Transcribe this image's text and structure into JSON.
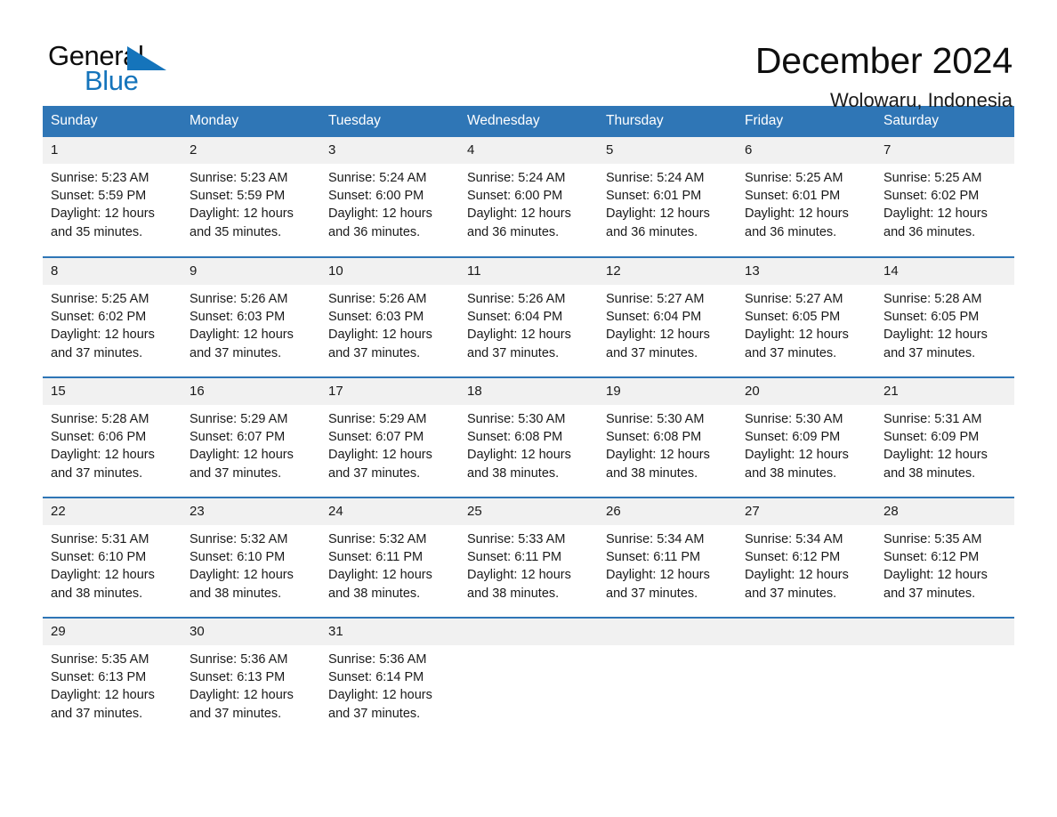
{
  "brand": {
    "name_part1": "General",
    "name_part2": "Blue",
    "accent_color": "#1574bb"
  },
  "header": {
    "title": "December 2024",
    "location": "Wolowaru, Indonesia"
  },
  "theme": {
    "header_blue": "#2f76b6",
    "daynum_bg": "#f1f1f1"
  },
  "weekdays": [
    "Sunday",
    "Monday",
    "Tuesday",
    "Wednesday",
    "Thursday",
    "Friday",
    "Saturday"
  ],
  "weeks": [
    [
      {
        "day": "1",
        "sunrise": "Sunrise: 5:23 AM",
        "sunset": "Sunset: 5:59 PM",
        "daylight": "Daylight: 12 hours\nand 35 minutes."
      },
      {
        "day": "2",
        "sunrise": "Sunrise: 5:23 AM",
        "sunset": "Sunset: 5:59 PM",
        "daylight": "Daylight: 12 hours\nand 35 minutes."
      },
      {
        "day": "3",
        "sunrise": "Sunrise: 5:24 AM",
        "sunset": "Sunset: 6:00 PM",
        "daylight": "Daylight: 12 hours\nand 36 minutes."
      },
      {
        "day": "4",
        "sunrise": "Sunrise: 5:24 AM",
        "sunset": "Sunset: 6:00 PM",
        "daylight": "Daylight: 12 hours\nand 36 minutes."
      },
      {
        "day": "5",
        "sunrise": "Sunrise: 5:24 AM",
        "sunset": "Sunset: 6:01 PM",
        "daylight": "Daylight: 12 hours\nand 36 minutes."
      },
      {
        "day": "6",
        "sunrise": "Sunrise: 5:25 AM",
        "sunset": "Sunset: 6:01 PM",
        "daylight": "Daylight: 12 hours\nand 36 minutes."
      },
      {
        "day": "7",
        "sunrise": "Sunrise: 5:25 AM",
        "sunset": "Sunset: 6:02 PM",
        "daylight": "Daylight: 12 hours\nand 36 minutes."
      }
    ],
    [
      {
        "day": "8",
        "sunrise": "Sunrise: 5:25 AM",
        "sunset": "Sunset: 6:02 PM",
        "daylight": "Daylight: 12 hours\nand 37 minutes."
      },
      {
        "day": "9",
        "sunrise": "Sunrise: 5:26 AM",
        "sunset": "Sunset: 6:03 PM",
        "daylight": "Daylight: 12 hours\nand 37 minutes."
      },
      {
        "day": "10",
        "sunrise": "Sunrise: 5:26 AM",
        "sunset": "Sunset: 6:03 PM",
        "daylight": "Daylight: 12 hours\nand 37 minutes."
      },
      {
        "day": "11",
        "sunrise": "Sunrise: 5:26 AM",
        "sunset": "Sunset: 6:04 PM",
        "daylight": "Daylight: 12 hours\nand 37 minutes."
      },
      {
        "day": "12",
        "sunrise": "Sunrise: 5:27 AM",
        "sunset": "Sunset: 6:04 PM",
        "daylight": "Daylight: 12 hours\nand 37 minutes."
      },
      {
        "day": "13",
        "sunrise": "Sunrise: 5:27 AM",
        "sunset": "Sunset: 6:05 PM",
        "daylight": "Daylight: 12 hours\nand 37 minutes."
      },
      {
        "day": "14",
        "sunrise": "Sunrise: 5:28 AM",
        "sunset": "Sunset: 6:05 PM",
        "daylight": "Daylight: 12 hours\nand 37 minutes."
      }
    ],
    [
      {
        "day": "15",
        "sunrise": "Sunrise: 5:28 AM",
        "sunset": "Sunset: 6:06 PM",
        "daylight": "Daylight: 12 hours\nand 37 minutes."
      },
      {
        "day": "16",
        "sunrise": "Sunrise: 5:29 AM",
        "sunset": "Sunset: 6:07 PM",
        "daylight": "Daylight: 12 hours\nand 37 minutes."
      },
      {
        "day": "17",
        "sunrise": "Sunrise: 5:29 AM",
        "sunset": "Sunset: 6:07 PM",
        "daylight": "Daylight: 12 hours\nand 37 minutes."
      },
      {
        "day": "18",
        "sunrise": "Sunrise: 5:30 AM",
        "sunset": "Sunset: 6:08 PM",
        "daylight": "Daylight: 12 hours\nand 38 minutes."
      },
      {
        "day": "19",
        "sunrise": "Sunrise: 5:30 AM",
        "sunset": "Sunset: 6:08 PM",
        "daylight": "Daylight: 12 hours\nand 38 minutes."
      },
      {
        "day": "20",
        "sunrise": "Sunrise: 5:30 AM",
        "sunset": "Sunset: 6:09 PM",
        "daylight": "Daylight: 12 hours\nand 38 minutes."
      },
      {
        "day": "21",
        "sunrise": "Sunrise: 5:31 AM",
        "sunset": "Sunset: 6:09 PM",
        "daylight": "Daylight: 12 hours\nand 38 minutes."
      }
    ],
    [
      {
        "day": "22",
        "sunrise": "Sunrise: 5:31 AM",
        "sunset": "Sunset: 6:10 PM",
        "daylight": "Daylight: 12 hours\nand 38 minutes."
      },
      {
        "day": "23",
        "sunrise": "Sunrise: 5:32 AM",
        "sunset": "Sunset: 6:10 PM",
        "daylight": "Daylight: 12 hours\nand 38 minutes."
      },
      {
        "day": "24",
        "sunrise": "Sunrise: 5:32 AM",
        "sunset": "Sunset: 6:11 PM",
        "daylight": "Daylight: 12 hours\nand 38 minutes."
      },
      {
        "day": "25",
        "sunrise": "Sunrise: 5:33 AM",
        "sunset": "Sunset: 6:11 PM",
        "daylight": "Daylight: 12 hours\nand 38 minutes."
      },
      {
        "day": "26",
        "sunrise": "Sunrise: 5:34 AM",
        "sunset": "Sunset: 6:11 PM",
        "daylight": "Daylight: 12 hours\nand 37 minutes."
      },
      {
        "day": "27",
        "sunrise": "Sunrise: 5:34 AM",
        "sunset": "Sunset: 6:12 PM",
        "daylight": "Daylight: 12 hours\nand 37 minutes."
      },
      {
        "day": "28",
        "sunrise": "Sunrise: 5:35 AM",
        "sunset": "Sunset: 6:12 PM",
        "daylight": "Daylight: 12 hours\nand 37 minutes."
      }
    ],
    [
      {
        "day": "29",
        "sunrise": "Sunrise: 5:35 AM",
        "sunset": "Sunset: 6:13 PM",
        "daylight": "Daylight: 12 hours\nand 37 minutes."
      },
      {
        "day": "30",
        "sunrise": "Sunrise: 5:36 AM",
        "sunset": "Sunset: 6:13 PM",
        "daylight": "Daylight: 12 hours\nand 37 minutes."
      },
      {
        "day": "31",
        "sunrise": "Sunrise: 5:36 AM",
        "sunset": "Sunset: 6:14 PM",
        "daylight": "Daylight: 12 hours\nand 37 minutes."
      },
      {
        "day": "",
        "sunrise": "",
        "sunset": "",
        "daylight": ""
      },
      {
        "day": "",
        "sunrise": "",
        "sunset": "",
        "daylight": ""
      },
      {
        "day": "",
        "sunrise": "",
        "sunset": "",
        "daylight": ""
      },
      {
        "day": "",
        "sunrise": "",
        "sunset": "",
        "daylight": ""
      }
    ]
  ]
}
